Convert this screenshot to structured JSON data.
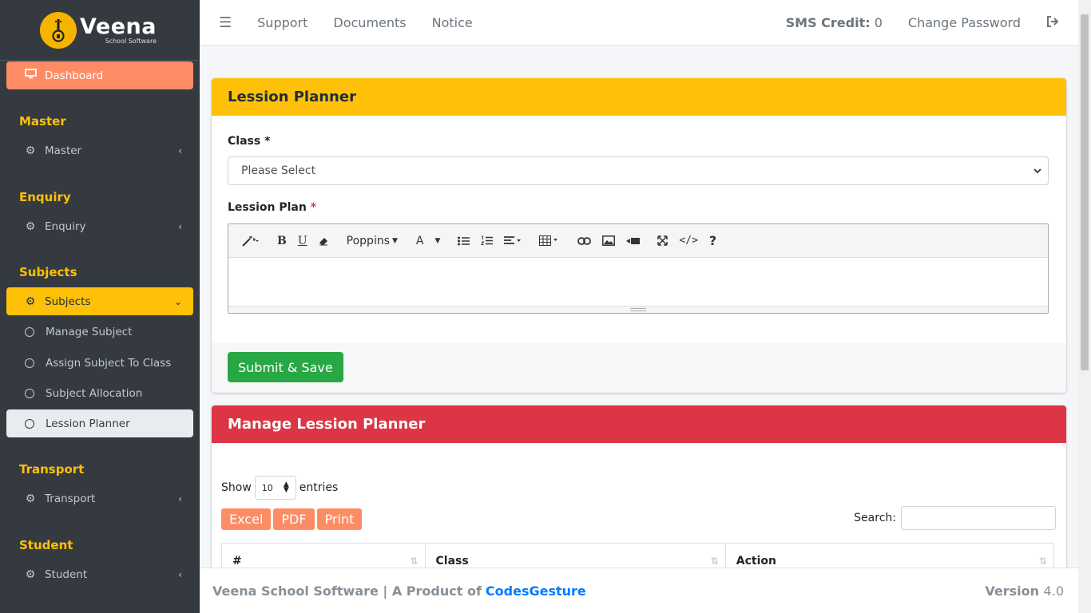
{
  "brand": {
    "name": "Veena",
    "tagline": "School Software"
  },
  "sidebar": {
    "dashboard": "Dashboard",
    "sections": [
      {
        "header": "Master",
        "item": "Master"
      },
      {
        "header": "Enquiry",
        "item": "Enquiry"
      },
      {
        "header": "Subjects",
        "item": "Subjects"
      },
      {
        "header": "Transport",
        "item": "Transport"
      },
      {
        "header": "Student",
        "item": "Student"
      }
    ],
    "subitems": [
      "Manage Subject",
      "Assign Subject To Class",
      "Subject Allocation",
      "Lession Planner"
    ]
  },
  "topbar": {
    "links": [
      "Support",
      "Documents",
      "Notice"
    ],
    "sms_label": "SMS Credit:",
    "sms_value": "0",
    "change_password": "Change Password"
  },
  "form": {
    "title": "Lession Planner",
    "class_label": "Class",
    "class_placeholder": "Please Select",
    "plan_label": "Lession Plan",
    "required_mark": "*",
    "font_name": "Poppins",
    "submit_label": "Submit & Save"
  },
  "manage": {
    "title": "Manage Lession Planner",
    "show_label": "Show",
    "entries_value": "10",
    "entries_label": "entries",
    "buttons": [
      "Excel",
      "PDF",
      "Print"
    ],
    "search_label": "Search:",
    "columns": [
      "#",
      "Class",
      "Action"
    ]
  },
  "footer": {
    "text": "Veena School Software | A Product of",
    "company": "CodesGesture",
    "version_label": "Version",
    "version_value": "4.0"
  },
  "colors": {
    "sidebar_bg": "#343a40",
    "accent_orange": "#fd8c65",
    "accent_yellow": "#ffc107",
    "danger_red": "#dc3545",
    "success_green": "#28a745",
    "link_blue": "#007bff"
  }
}
